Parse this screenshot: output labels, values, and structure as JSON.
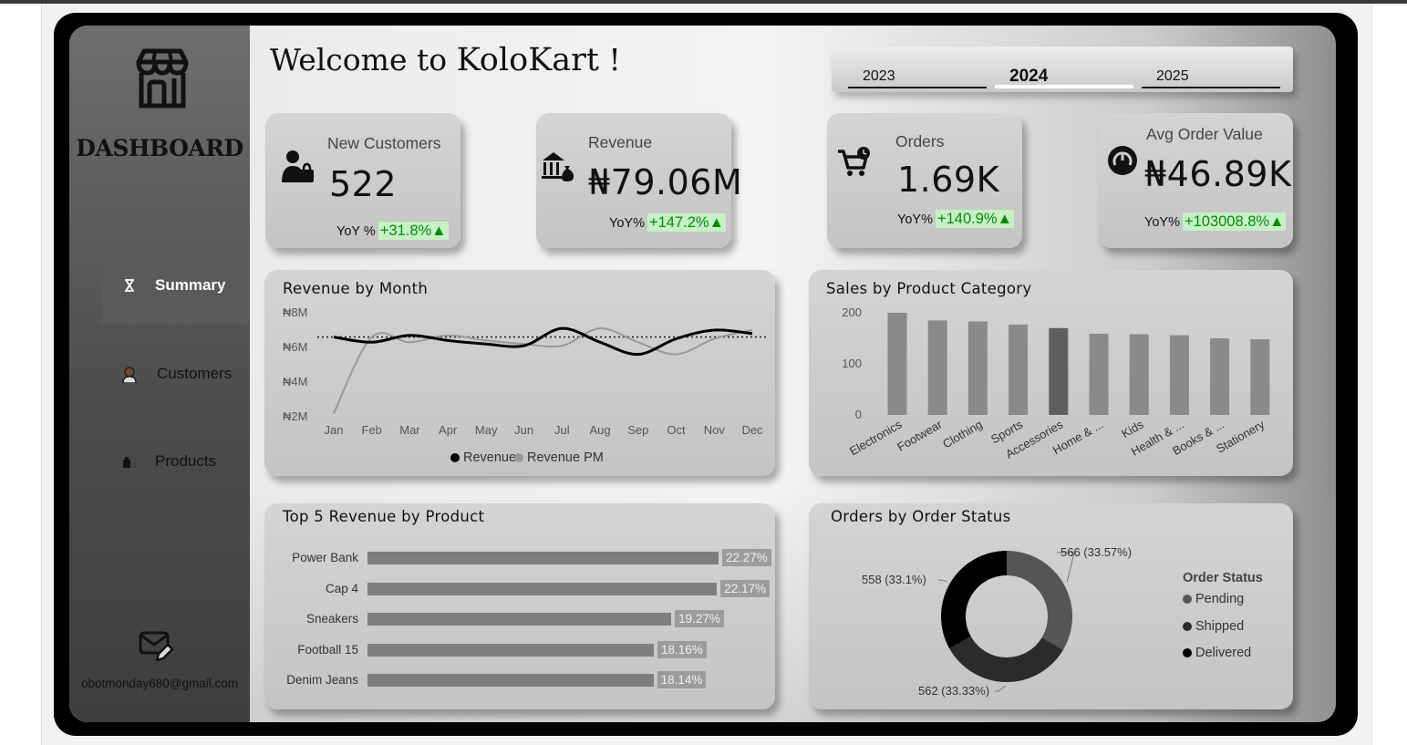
{
  "sidebar": {
    "title": "DASHBOARD",
    "nav": [
      {
        "label": "Summary",
        "icon": "hourglass-icon",
        "active": true
      },
      {
        "label": "Customers",
        "icon": "user-icon",
        "active": false
      },
      {
        "label": "Products",
        "icon": "shop-icon",
        "active": false
      }
    ],
    "email": "obotmonday680@gmail.com"
  },
  "header": {
    "welcome_prefix": "Welcome to ",
    "brand": "KoloKart",
    "welcome_suffix": " !"
  },
  "year_slicer": {
    "options": [
      "2023",
      "2024",
      "2025"
    ],
    "selected": "2024"
  },
  "kpis": {
    "new_customers": {
      "label": "New Customers",
      "value": "522",
      "yoy_label": "YoY %",
      "yoy_change": "+31.8%▲"
    },
    "revenue": {
      "label": "Revenue",
      "value": "₦79.06M",
      "yoy_label": "YoY%",
      "yoy_change": "+147.2%▲"
    },
    "orders": {
      "label": "Orders",
      "value": "1.69K",
      "yoy_label": "YoY%",
      "yoy_change": "+140.9%▲"
    },
    "avg_order_value": {
      "label": "Avg Order Value",
      "value": "₦46.89K",
      "yoy_label": "YoY%",
      "yoy_change": "+103008.8%▲"
    }
  },
  "colors": {
    "positive_text": "#0a8a0a",
    "positive_bg": "#c6f0c6",
    "accent_dark": "#000000",
    "accent_gray": "#999999"
  },
  "chart_data": [
    {
      "type": "line",
      "title": "Revenue by Month",
      "x": [
        "Jan",
        "Feb",
        "Mar",
        "Apr",
        "May",
        "Jun",
        "Jul",
        "Aug",
        "Sep",
        "Oct",
        "Nov",
        "Dec"
      ],
      "yticks": [
        "₦8M",
        "₦6M",
        "₦4M",
        "₦2M"
      ],
      "ylim": [
        2,
        8
      ],
      "series": [
        {
          "name": "Revenue",
          "color": "#000000",
          "values": [
            6.6,
            6.3,
            6.7,
            6.4,
            6.2,
            6.1,
            7.1,
            6.3,
            5.6,
            6.5,
            7.0,
            6.8
          ]
        },
        {
          "name": "Revenue PM",
          "color": "#999999",
          "values": [
            2.2,
            6.6,
            6.3,
            6.7,
            6.4,
            6.2,
            6.1,
            7.1,
            6.3,
            5.6,
            6.5,
            7.0
          ]
        }
      ],
      "reference_line": 6.6,
      "legend_position": "bottom"
    },
    {
      "type": "bar",
      "title": "Sales by Product Category",
      "categories": [
        "Electronics",
        "Footwear",
        "Clothing",
        "Sports",
        "Accessories",
        "Home & ...",
        "Kids",
        "Health & ...",
        "Books & ...",
        "Stationery"
      ],
      "values": [
        200,
        185,
        183,
        177,
        170,
        159,
        158,
        156,
        150,
        148
      ],
      "yticks": [
        "200",
        "100",
        "0"
      ],
      "ylim": [
        0,
        200
      ],
      "highlighted": [
        "Accessories"
      ]
    },
    {
      "type": "bar",
      "orientation": "horizontal",
      "title": "Top 5 Revenue by Product",
      "categories": [
        "Power Bank",
        "Cap 4",
        "Sneakers",
        "Football 15",
        "Denim Jeans"
      ],
      "values": [
        22.27,
        22.17,
        19.27,
        18.16,
        18.14
      ],
      "labels": [
        "22.27%",
        "22.17%",
        "19.27%",
        "18.16%",
        "18.14%"
      ]
    },
    {
      "type": "pie",
      "variant": "donut",
      "title": "Orders by Order Status",
      "legend_title": "Order Status",
      "categories": [
        "Pending",
        "Shipped",
        "Delivered"
      ],
      "values": [
        566,
        562,
        558
      ],
      "labels": [
        "566 (33.57%)",
        "562 (33.33%)",
        "558 (33.1%)"
      ],
      "colors": [
        "#555555",
        "#2b2b2b",
        "#000000"
      ],
      "legend_position": "right"
    }
  ]
}
